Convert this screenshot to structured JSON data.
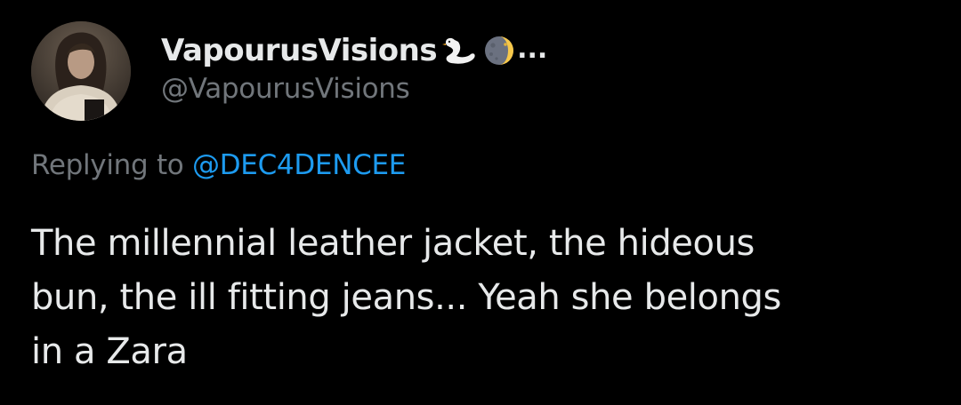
{
  "tweet": {
    "author": {
      "display_name": "VapourusVisions",
      "handle": "@VapourusVisions",
      "name_emojis": [
        "swan-emoji",
        "waning-moon-emoji"
      ],
      "truncation": "..."
    },
    "reply": {
      "prefix": "Replying to",
      "mention": "@DEC4DENCEE"
    },
    "text": "The millennial leather jacket, the hideous\nbun, the ill fitting jeans... Yeah she belongs\nin a Zara"
  },
  "colors": {
    "background": "#000000",
    "primary_text": "#e7e9ea",
    "secondary_text": "#71767b",
    "link": "#1d9bf0"
  }
}
